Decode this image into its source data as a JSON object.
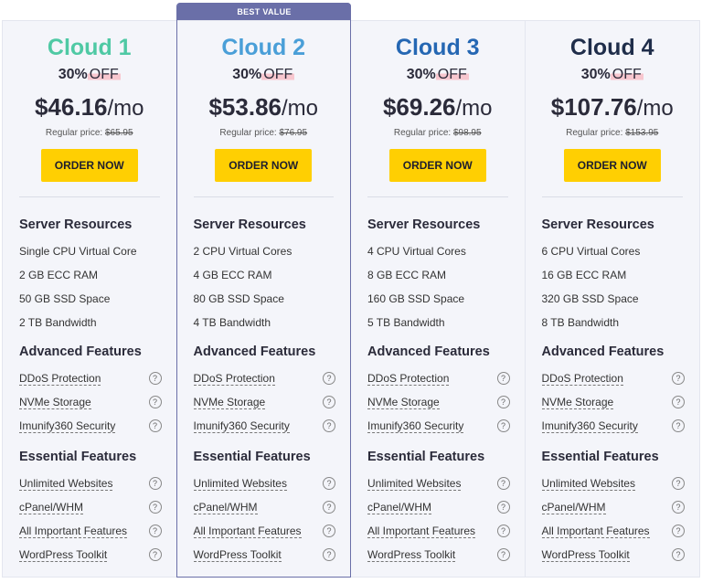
{
  "badge": "BEST VALUE",
  "order_label": "ORDER NOW",
  "regular_prefix": "Regular price:",
  "sections": {
    "resources": "Server Resources",
    "advanced": "Advanced Features",
    "essential": "Essential Features"
  },
  "advanced_features": [
    "DDoS Protection",
    "NVMe Storage",
    "Imunify360 Security"
  ],
  "essential_features": [
    "Unlimited Websites",
    "cPanel/WHM",
    "All Important Features",
    "WordPress Toolkit"
  ],
  "plans": [
    {
      "name": "Cloud 1",
      "color": "#4fc9a4",
      "pct": "30%",
      "off": "OFF",
      "price": "$46.16",
      "per": "/mo",
      "regular": "$65.95",
      "resources": [
        "Single CPU Virtual Core",
        "2 GB ECC RAM",
        "50 GB SSD Space",
        "2 TB Bandwidth"
      ]
    },
    {
      "name": "Cloud 2",
      "color": "#4a9fd8",
      "pct": "30%",
      "off": "OFF",
      "price": "$53.86",
      "per": "/mo",
      "regular": "$76.95",
      "resources": [
        "2 CPU Virtual Cores",
        "4 GB ECC RAM",
        "80 GB SSD Space",
        "4 TB Bandwidth"
      ]
    },
    {
      "name": "Cloud 3",
      "color": "#2567b3",
      "pct": "30%",
      "off": "OFF",
      "price": "$69.26",
      "per": "/mo",
      "regular": "$98.95",
      "resources": [
        "4 CPU Virtual Cores",
        "8 GB ECC RAM",
        "160 GB SSD Space",
        "5 TB Bandwidth"
      ]
    },
    {
      "name": "Cloud 4",
      "color": "#1f2d4a",
      "pct": "30%",
      "off": "OFF",
      "price": "$107.76",
      "per": "/mo",
      "regular": "$153.95",
      "resources": [
        "6 CPU Virtual Cores",
        "16 GB ECC RAM",
        "320 GB SSD Space",
        "8 TB Bandwidth"
      ]
    }
  ]
}
